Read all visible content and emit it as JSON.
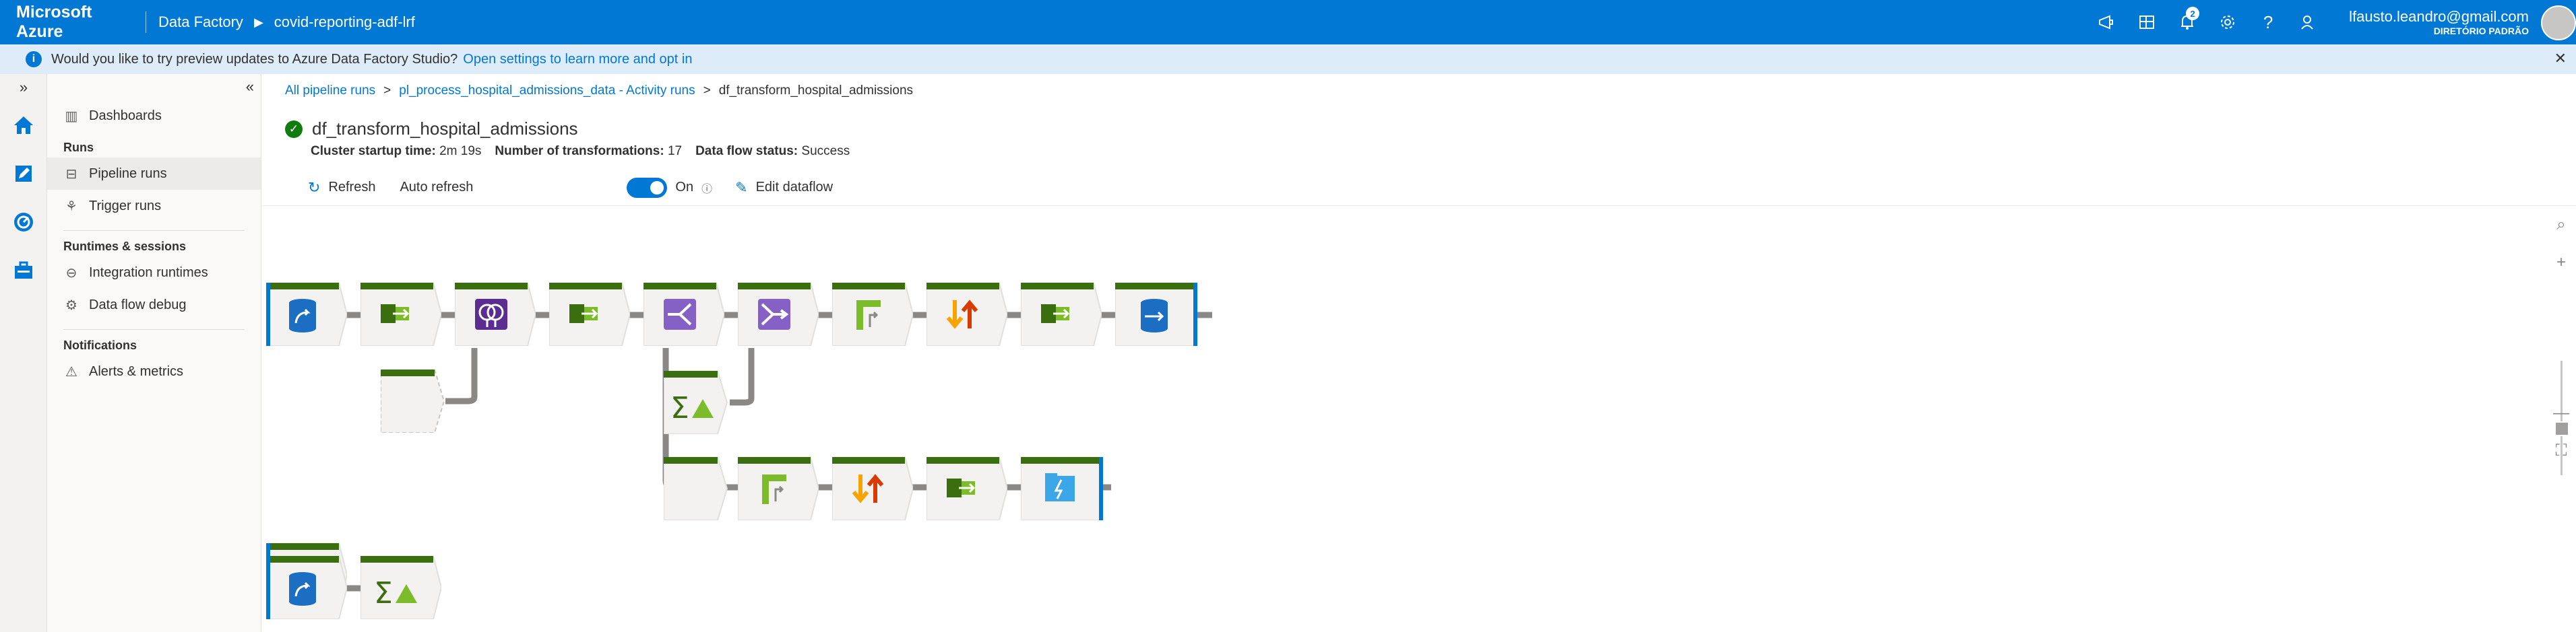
{
  "topbar": {
    "brand": "Microsoft Azure",
    "service": "Data Factory",
    "factory": "covid-reporting-adf-lrf",
    "notification_count": "2",
    "user_email": "lfausto.leandro@gmail.com",
    "user_directory": "DIRETÓRIO PADRÃO",
    "icons": [
      "feedback-icon",
      "portal-icon",
      "bell-icon",
      "gear-icon",
      "help-icon",
      "user-feedback-icon"
    ]
  },
  "infobar": {
    "message": "Would you like to try preview updates to Azure Data Factory Studio?",
    "link": "Open settings to learn more and opt in"
  },
  "sidenav": {
    "dashboards": "Dashboards",
    "runs_header": "Runs",
    "pipeline_runs": "Pipeline runs",
    "trigger_runs": "Trigger runs",
    "runtimes_header": "Runtimes & sessions",
    "integration_runtimes": "Integration runtimes",
    "data_flow_debug": "Data flow debug",
    "notifications_header": "Notifications",
    "alerts_metrics": "Alerts & metrics"
  },
  "breadcrumb": {
    "all_runs": "All pipeline runs",
    "pipeline": "pl_process_hospital_admissions_data - Activity runs",
    "current": "df_transform_hospital_admissions",
    "separator": ">"
  },
  "header": {
    "title": "df_transform_hospital_admissions",
    "cluster_label": "Cluster startup time:",
    "cluster_value": "2m 19s",
    "transforms_label": "Number of transformations:",
    "transforms_value": "17",
    "status_label": "Data flow status:",
    "status_value": "Success"
  },
  "toolbar": {
    "refresh": "Refresh",
    "auto_refresh": "Auto refresh",
    "toggle_state": "On",
    "edit_dataflow": "Edit dataflow"
  },
  "colors": {
    "azure_blue": "#0078d4",
    "node_green": "#3a6e0f",
    "success": "#107c10"
  }
}
